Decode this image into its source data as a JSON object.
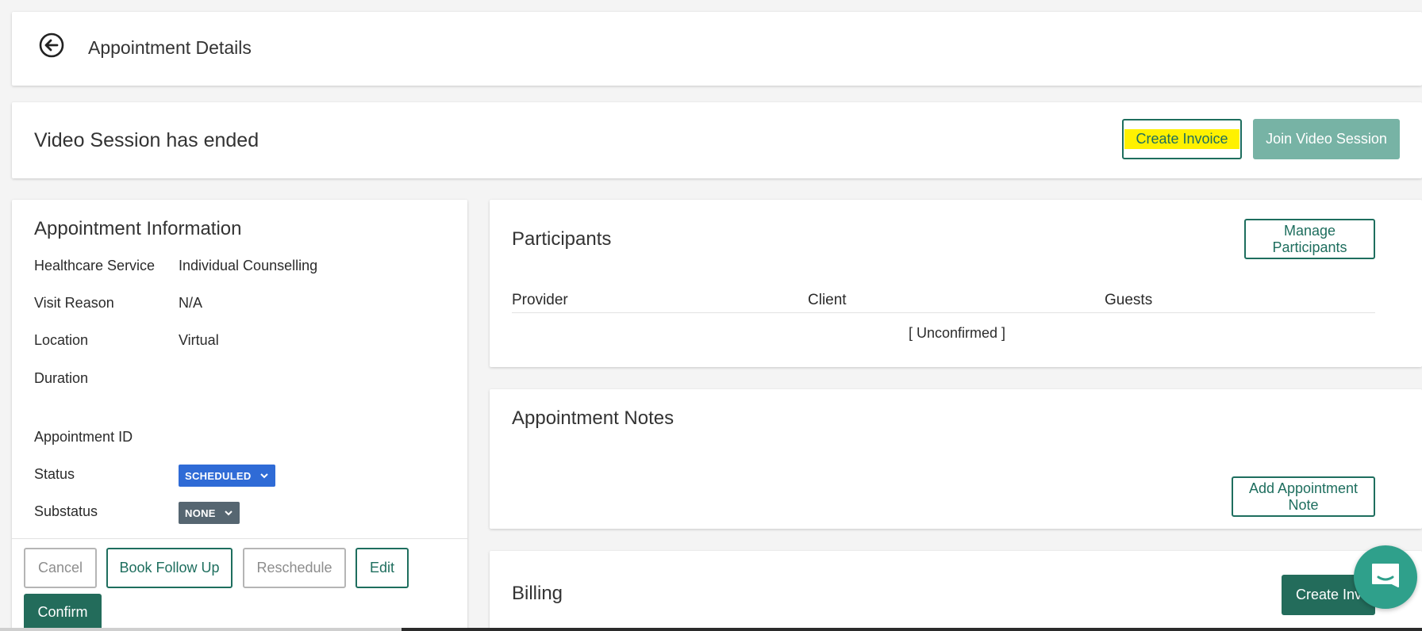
{
  "header": {
    "back_icon": "arrow-left-circle-icon",
    "title": "Appointment Details"
  },
  "session_banner": {
    "message": "Video Session has ended",
    "create_invoice_label": "Create Invoice",
    "join_video_label": "Join Video Session",
    "highlight_color": "#fff100"
  },
  "appointment_info": {
    "title": "Appointment Information",
    "rows": [
      {
        "label": "Healthcare Service",
        "value": "Individual Counselling"
      },
      {
        "label": "Visit Reason",
        "value": "N/A"
      },
      {
        "label": "Location",
        "value": "Virtual"
      },
      {
        "label": "Duration",
        "value": ""
      },
      {
        "label": "Appointment ID",
        "value": ""
      }
    ],
    "status_label": "Status",
    "status_value": "SCHEDULED",
    "status_color": "#2f6bd6",
    "substatus_label": "Substatus",
    "substatus_value": "NONE",
    "substatus_color": "#566671",
    "actions": {
      "cancel": "Cancel",
      "book_follow_up": "Book Follow Up",
      "reschedule": "Reschedule",
      "edit": "Edit",
      "confirm": "Confirm"
    }
  },
  "participants": {
    "title": "Participants",
    "manage_label": "Manage Participants",
    "columns": [
      "Provider",
      "Client",
      "Guests"
    ],
    "client_status": "[ Unconfirmed ]"
  },
  "notes": {
    "title": "Appointment Notes",
    "add_label": "Add Appointment Note"
  },
  "billing": {
    "title": "Billing",
    "create_invoice_label": "Create Invoice"
  },
  "chat_widget": {
    "icon": "chat-bubble-icon",
    "color": "#2fa08b"
  },
  "colors": {
    "accent": "#1e6e5e",
    "join_button": "#77b3a5"
  }
}
